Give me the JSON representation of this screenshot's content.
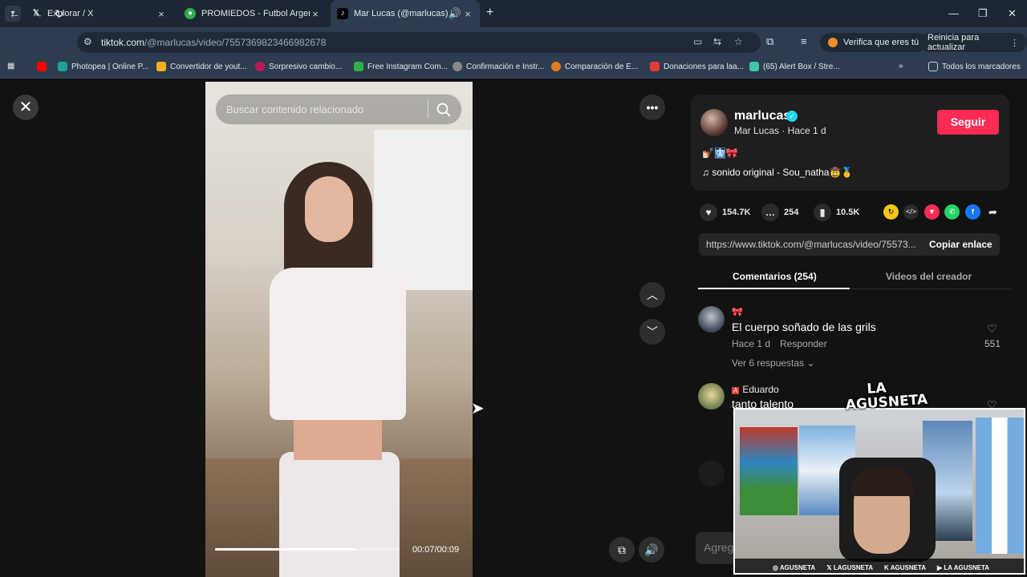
{
  "browser": {
    "tabs": [
      {
        "title": "Explorar / X",
        "favicon": "X",
        "active": false
      },
      {
        "title": "PROMIEDOS - Futbol Argentino",
        "favicon": "promiedos",
        "active": false
      },
      {
        "title": "Mar Lucas (@marlucas) oficial",
        "favicon": "tiktok",
        "active": true
      }
    ],
    "url_host": "tiktok.com",
    "url_path": "/@marlucas/video/7557369823466982678",
    "pill_verify": "Verifica que eres tú",
    "pill_update": "Reinicia para actualizar",
    "bookmarks": [
      "Photopea | Online P...",
      "Convertidor de yout...",
      "Sorpresivo cambio...",
      "Free Instagram Com...",
      "Confirmación e Instr...",
      "Comparación de E...",
      "Donaciones para laa...",
      "(65) Alert Box / Stre..."
    ],
    "bookmarks_all": "Todos los marcadores"
  },
  "video": {
    "search_placeholder": "Buscar contenido relacionado",
    "time": "00:07/00:09",
    "progress": 0.76
  },
  "panel": {
    "username": "marlucas",
    "subname": "Mar Lucas · Hace 1 d",
    "follow_label": "Seguir",
    "description": "💅🏻🩻🎀",
    "music": "sonido original - Sou_natha🤠🥇",
    "likes": "154.7K",
    "comments_count": "254",
    "saves": "10.5K",
    "link": "https://www.tiktok.com/@marlucas/video/75573...",
    "copy_label": "Copiar enlace",
    "tab_comments": "Comentarios (254)",
    "tab_videos": "Videos del creador",
    "comments": [
      {
        "author": "🎀",
        "text": "El cuerpo soñado de las grils",
        "time": "Hace 1 d",
        "reply": "Responder",
        "likes": "551",
        "view_replies": "Ver 6 respuestas"
      },
      {
        "author": "Eduardo",
        "text": "tanto talento"
      }
    ],
    "add_comment_placeholder": "Agregar comentario..."
  },
  "overlay": {
    "logo_line1": "LA",
    "logo_line2": "AGUSNETA",
    "handles": [
      "AGUSNETA",
      "LAGUSNETA",
      "AGUSNETA",
      "LA AGUSNETA"
    ]
  },
  "colors": {
    "follow": "#fe2c55",
    "verified": "#20d5ec",
    "chrome_bg": "#2d3d4f"
  }
}
